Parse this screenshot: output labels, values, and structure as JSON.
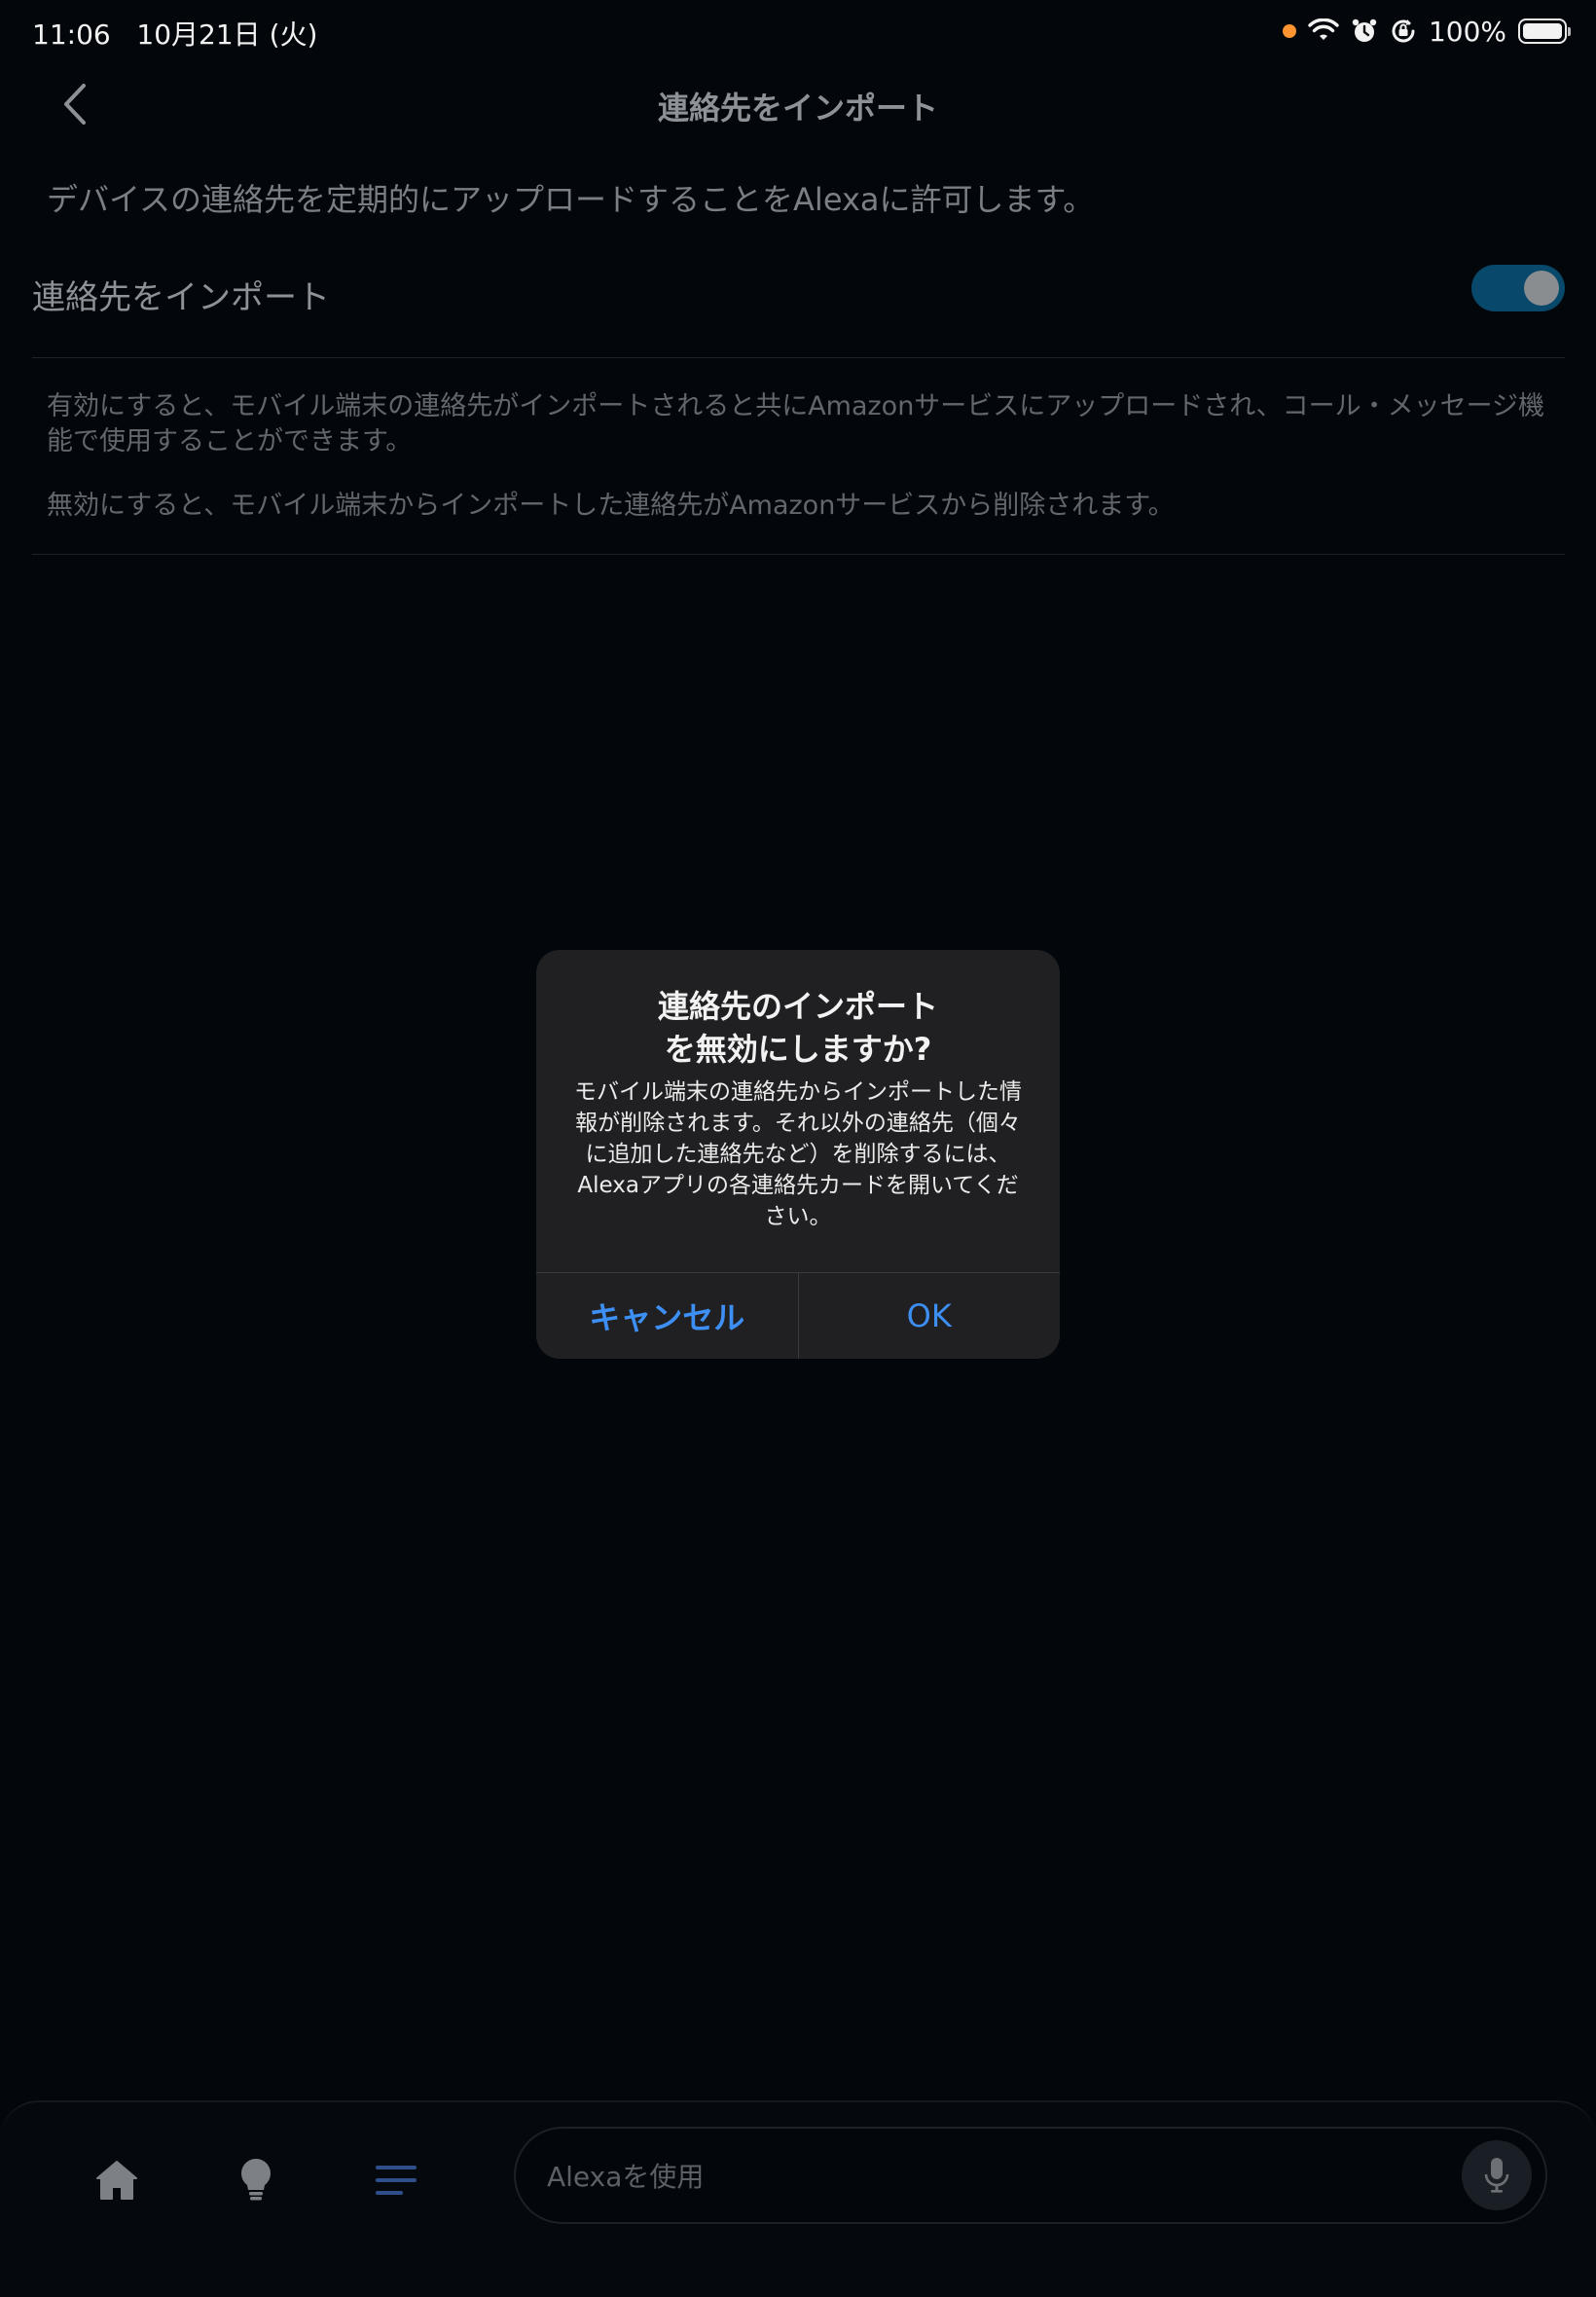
{
  "status_bar": {
    "time": "11:06",
    "date": "10月21日 (火)",
    "battery": "100%"
  },
  "header": {
    "title": "連絡先をインポート"
  },
  "intro": "デバイスの連絡先を定期的にアップロードすることをAlexaに許可します。",
  "import_setting": {
    "label": "連絡先をインポート",
    "enabled": true
  },
  "description": {
    "p1": "有効にすると、モバイル端末の連絡先がインポートされると共にAmazonサービスにアップロードされ、コール・メッセージ機能で使用することができます。",
    "p2": "無効にすると、モバイル端末からインポートした連絡先がAmazonサービスから削除されます。"
  },
  "dialog": {
    "title_line1": "連絡先のインポート",
    "title_line2": "を無効にしますか?",
    "message": "モバイル端末の連絡先からインポートした情報が削除されます。それ以外の連絡先（個々に追加した連絡先など）を削除するには、Alexaアプリの各連絡先カードを開いてください。",
    "cancel_label": "キャンセル",
    "ok_label": "OK",
    "button_color": "#3d8ff3"
  },
  "bottom_bar": {
    "input_placeholder": "Alexaを使用",
    "nav_items": [
      "home-icon",
      "lightbulb-icon",
      "more-icon"
    ]
  }
}
